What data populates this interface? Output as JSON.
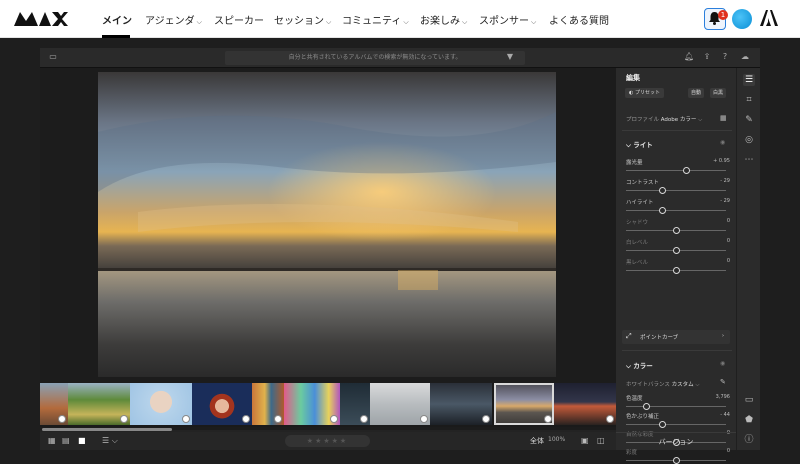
{
  "site_nav": {
    "logo_text": "MAX",
    "items": [
      {
        "label": "メイン",
        "active": true,
        "has_dropdown": false
      },
      {
        "label": "アジェンダ",
        "active": false,
        "has_dropdown": true
      },
      {
        "label": "スピーカー",
        "active": false,
        "has_dropdown": false
      },
      {
        "label": "セッション",
        "active": false,
        "has_dropdown": true
      },
      {
        "label": "コミュニティ",
        "active": false,
        "has_dropdown": true
      },
      {
        "label": "お楽しみ",
        "active": false,
        "has_dropdown": true
      },
      {
        "label": "スポンサー",
        "active": false,
        "has_dropdown": true
      },
      {
        "label": "よくある質問",
        "active": false,
        "has_dropdown": false
      }
    ],
    "notification_count": "1",
    "accent_color": "#2b7fdc"
  },
  "app": {
    "search_text": "自分と共有されているアルバムでの検索が無効になっています。",
    "toolbar_icons": [
      "panel-toggle-icon",
      "filter-icon",
      "bell-icon",
      "share-icon",
      "help-icon",
      "cloud-icon"
    ]
  },
  "edit_panel": {
    "title": "編集",
    "preset_label": "プリセット",
    "auto_label": "自動",
    "bw_label": "白黒",
    "profile_label": "プロファイル",
    "profile_value": "Adobe カラー",
    "light": {
      "title": "ライト",
      "sliders": [
        {
          "label": "露光量",
          "value": "+ 0.95",
          "position": 0.6,
          "enabled": true
        },
        {
          "label": "コントラスト",
          "value": "- 29",
          "position": 0.36,
          "enabled": true
        },
        {
          "label": "ハイライト",
          "value": "- 29",
          "position": 0.36,
          "enabled": true
        },
        {
          "label": "シャドウ",
          "value": "0",
          "position": 0.5,
          "enabled": false
        },
        {
          "label": "白レベル",
          "value": "0",
          "position": 0.5,
          "enabled": false
        },
        {
          "label": "黒レベル",
          "value": "0",
          "position": 0.5,
          "enabled": false
        }
      ],
      "point_curve_label": "ポイントカーブ"
    },
    "color": {
      "title": "カラー",
      "white_balance_label": "ホワイトバランス",
      "white_balance_value": "カスタム",
      "sliders": [
        {
          "label": "色温度",
          "value": "3,796",
          "position": 0.2,
          "enabled": true
        },
        {
          "label": "色かぶり補正",
          "value": "- 44",
          "position": 0.36,
          "enabled": true
        },
        {
          "label": "自然な彩度",
          "value": "0",
          "position": 0.5,
          "enabled": false
        },
        {
          "label": "彩度",
          "value": "0",
          "position": 0.5,
          "enabled": false
        }
      ]
    },
    "version_label": "バージョン"
  },
  "bottom_bar": {
    "zoom_fit_label": "全体",
    "zoom_value": "100%"
  },
  "filmstrip": {
    "thumbnails": [
      {
        "name": "monument-valley",
        "selected": false
      },
      {
        "name": "vineyard-hills",
        "selected": false
      },
      {
        "name": "elderly-woman-portrait",
        "selected": false
      },
      {
        "name": "redhead-woman-portrait",
        "selected": false
      },
      {
        "name": "canal-houses",
        "selected": false
      },
      {
        "name": "colorful-yarn",
        "selected": false
      },
      {
        "name": "dark-water",
        "selected": false
      },
      {
        "name": "foggy-lake",
        "selected": false
      },
      {
        "name": "night-reflection",
        "selected": false
      },
      {
        "name": "salt-flat-sunset",
        "selected": true
      },
      {
        "name": "dusk-horizon",
        "selected": false
      }
    ]
  }
}
